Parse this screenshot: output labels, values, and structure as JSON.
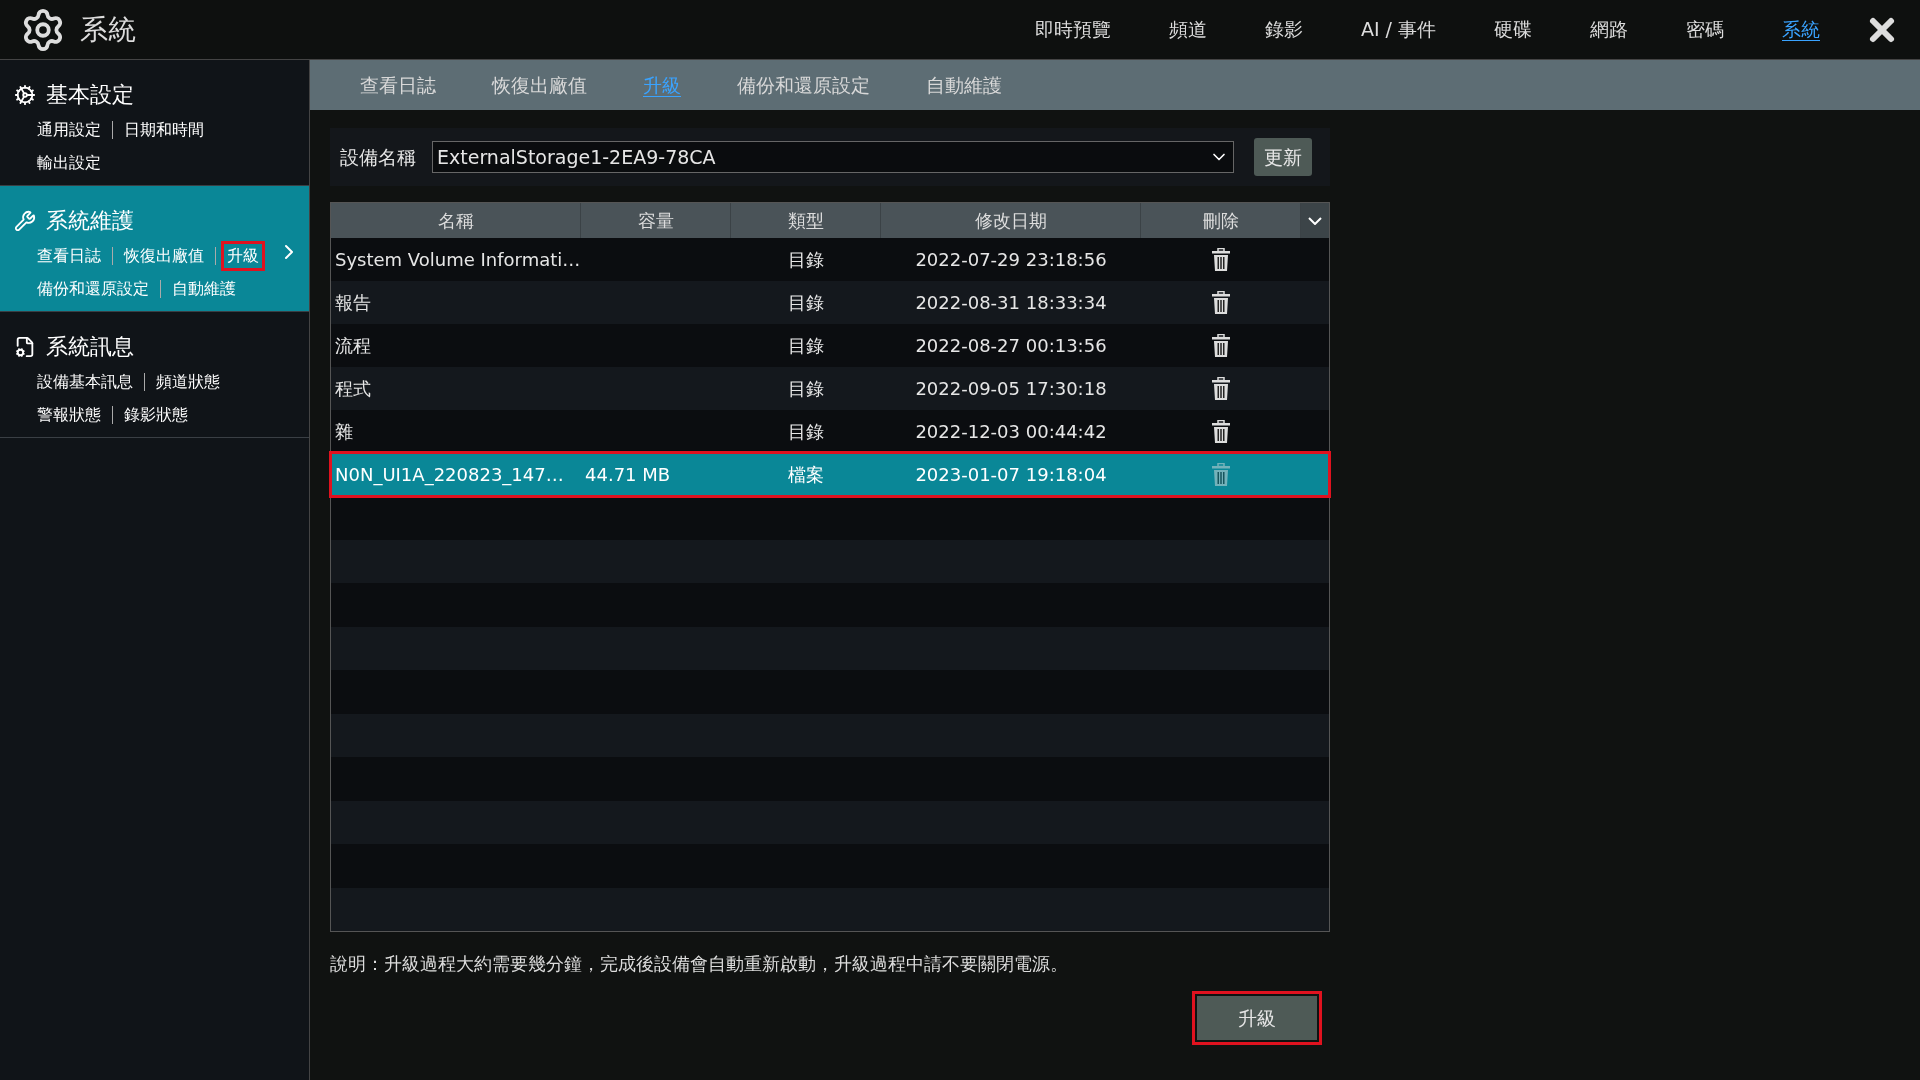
{
  "app": {
    "title": "系統"
  },
  "top_nav": [
    {
      "label": "即時預覽",
      "selected": false
    },
    {
      "label": "頻道",
      "selected": false
    },
    {
      "label": "錄影",
      "selected": false
    },
    {
      "label": "AI / 事件",
      "selected": false
    },
    {
      "label": "硬碟",
      "selected": false
    },
    {
      "label": "網路",
      "selected": false
    },
    {
      "label": "密碼",
      "selected": false
    },
    {
      "label": "系統",
      "selected": true
    }
  ],
  "sidebar": {
    "sections": [
      {
        "title": "基本設定",
        "kind": "gears",
        "selected": false,
        "rows": [
          [
            {
              "label": "通用設定",
              "highlighted": false
            },
            {
              "label": "日期和時間",
              "highlighted": false
            }
          ],
          [
            {
              "label": "輸出設定",
              "highlighted": false
            }
          ]
        ]
      },
      {
        "title": "系統維護",
        "kind": "tools",
        "selected": true,
        "rows": [
          [
            {
              "label": "查看日誌",
              "highlighted": false
            },
            {
              "label": "恢復出廠值",
              "highlighted": false
            },
            {
              "label": "升級",
              "highlighted": true
            }
          ],
          [
            {
              "label": "備份和還原設定",
              "highlighted": false
            },
            {
              "label": "自動維護",
              "highlighted": false
            }
          ]
        ]
      },
      {
        "title": "系統訊息",
        "kind": "info",
        "selected": false,
        "rows": [
          [
            {
              "label": "設備基本訊息",
              "highlighted": false
            },
            {
              "label": "頻道狀態",
              "highlighted": false
            }
          ],
          [
            {
              "label": "警報狀態",
              "highlighted": false
            },
            {
              "label": "錄影狀態",
              "highlighted": false
            }
          ]
        ]
      }
    ]
  },
  "sub_tabs": [
    {
      "label": "查看日誌",
      "selected": false
    },
    {
      "label": "恢復出廠值",
      "selected": false
    },
    {
      "label": "升級",
      "selected": true
    },
    {
      "label": "備份和還原設定",
      "selected": false
    },
    {
      "label": "自動維護",
      "selected": false
    }
  ],
  "device": {
    "label": "設備名稱",
    "value": "ExternalStorage1-2EA9-78CA",
    "button": "更新"
  },
  "table": {
    "columns": [
      "名稱",
      "容量",
      "類型",
      "修改日期",
      "刪除"
    ],
    "rows": [
      {
        "name": "System Volume Informati…",
        "size": "",
        "type": "目錄",
        "modified": "2022-07-29 23:18:56",
        "selected": false,
        "highlighted": false
      },
      {
        "name": "報告",
        "size": "",
        "type": "目錄",
        "modified": "2022-08-31 18:33:34",
        "selected": false,
        "highlighted": false
      },
      {
        "name": "流程",
        "size": "",
        "type": "目錄",
        "modified": "2022-08-27 00:13:56",
        "selected": false,
        "highlighted": false
      },
      {
        "name": "程式",
        "size": "",
        "type": "目錄",
        "modified": "2022-09-05 17:30:18",
        "selected": false,
        "highlighted": false
      },
      {
        "name": "雜",
        "size": "",
        "type": "目錄",
        "modified": "2022-12-03 00:44:42",
        "selected": false,
        "highlighted": false
      },
      {
        "name": "N0N_UI1A_220823_147…",
        "size": "44.71 MB",
        "type": "檔案",
        "modified": "2023-01-07 19:18:04",
        "selected": true,
        "highlighted": true
      }
    ]
  },
  "note": "說明：升級過程大約需要幾分鐘，完成後設備會自動重新啟動，升級過程中請不要關閉電源。",
  "upgrade_button": {
    "label": "升級",
    "highlighted": true
  }
}
